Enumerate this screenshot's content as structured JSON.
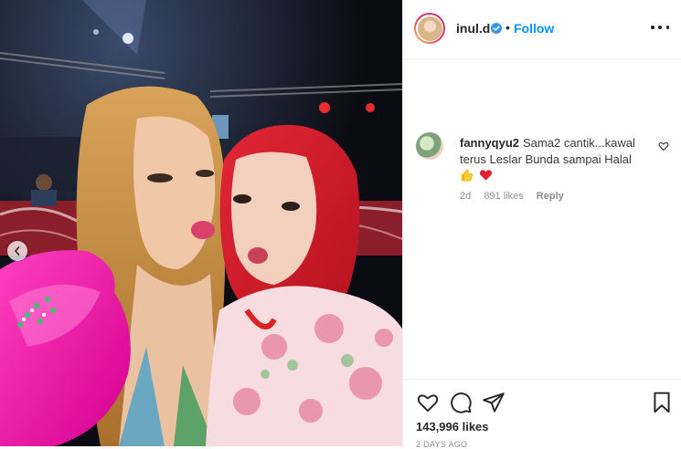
{
  "header": {
    "username": "inul.d",
    "separator": "•",
    "follow_label": "Follow"
  },
  "comment": {
    "username": "fannyqyu2",
    "text": "Sama2 cantik...kawal terus Leslar Bunda sampai Halal",
    "emojis": [
      "thumbs-up",
      "red-heart"
    ],
    "age": "2d",
    "likes": "891 likes",
    "reply_label": "Reply"
  },
  "actions": {
    "likes_count": "143,996 likes",
    "date": "2 DAYS AGO"
  },
  "icons": {
    "more": "more-options-icon",
    "verified": "verified-badge-icon",
    "like": "heart-icon",
    "comment": "comment-icon",
    "share": "share-icon",
    "save": "bookmark-icon",
    "prev": "chevron-left-icon"
  },
  "colors": {
    "link_blue": "#0095f6",
    "text": "#262626",
    "muted": "#8e8e8e"
  }
}
